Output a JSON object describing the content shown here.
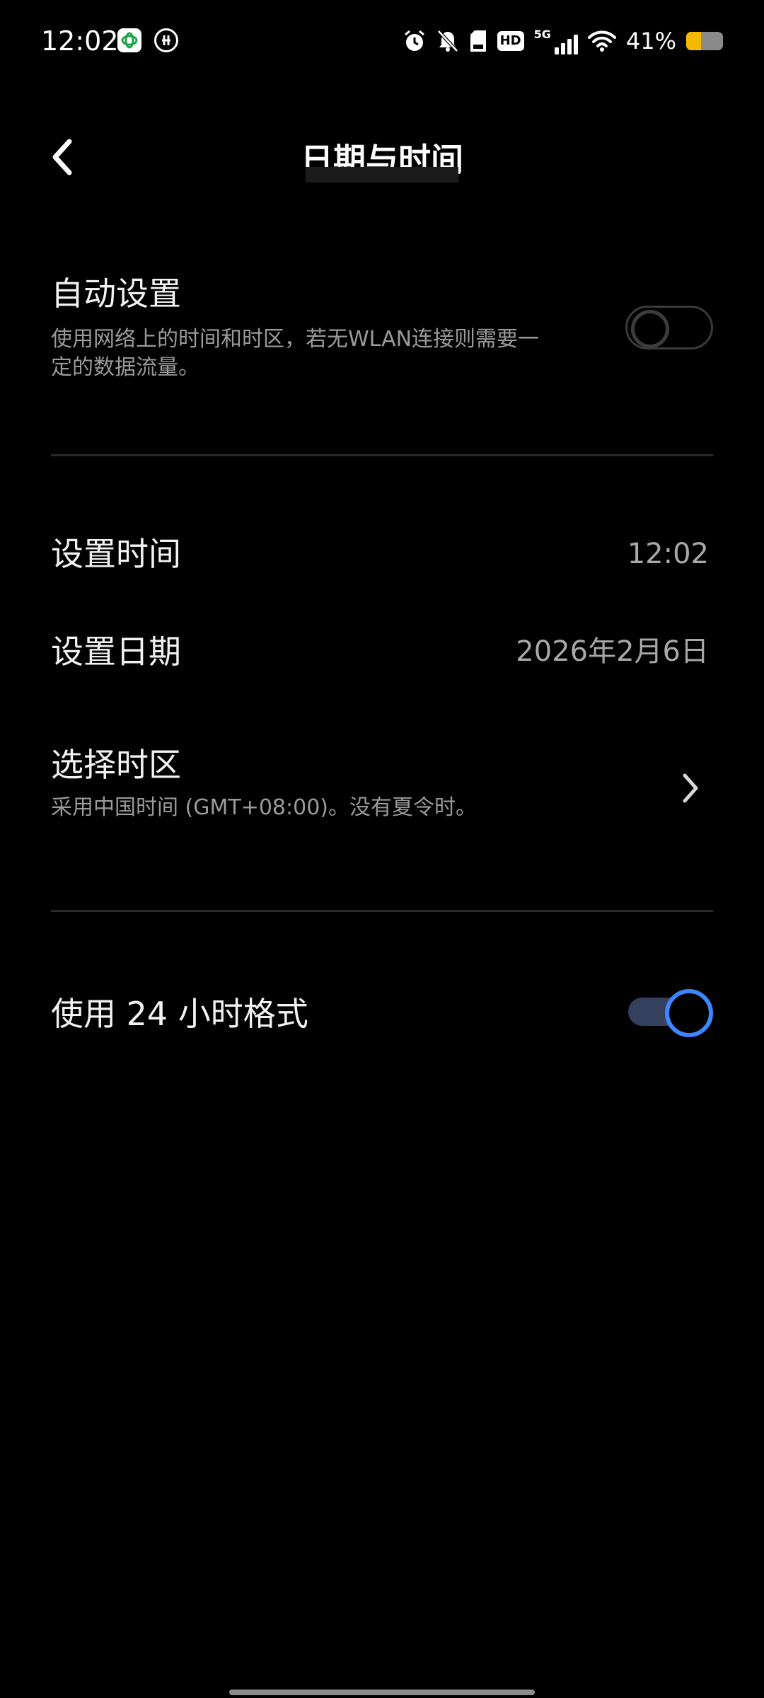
{
  "status_bar": {
    "time": "12:02",
    "battery_percent": "41%",
    "battery_level": 0.41,
    "hd_label": "HD",
    "network_label": "5G",
    "colors": {
      "battery_fill": "#f5b800",
      "mobile_icon": "#22a34a"
    },
    "icons": [
      "china-mobile-icon",
      "china-unicom-icon",
      "alarm-icon",
      "bell-off-icon",
      "sd-card-icon",
      "hd-icon",
      "signal-5g-icon",
      "wifi-icon",
      "battery-icon"
    ]
  },
  "header": {
    "title": "日期与时间"
  },
  "settings": {
    "auto_set": {
      "title": "自动设置",
      "subtitle": "使用网络上的时间和时区，若无WLAN连接则需要一定的数据流量。",
      "enabled": false
    },
    "set_time": {
      "title": "设置时间",
      "value": "12:02"
    },
    "set_date": {
      "title": "设置日期",
      "value": "2026年2月6日"
    },
    "timezone": {
      "title": "选择时区",
      "subtitle": "采用中国时间 (GMT+08:00)。没有夏令时。"
    },
    "format_24h": {
      "title": "使用 24 小时格式",
      "enabled": true
    }
  },
  "theme": {
    "accent": "#3d86ff",
    "toggle_track_on": "#33415e",
    "background": "#000000"
  }
}
